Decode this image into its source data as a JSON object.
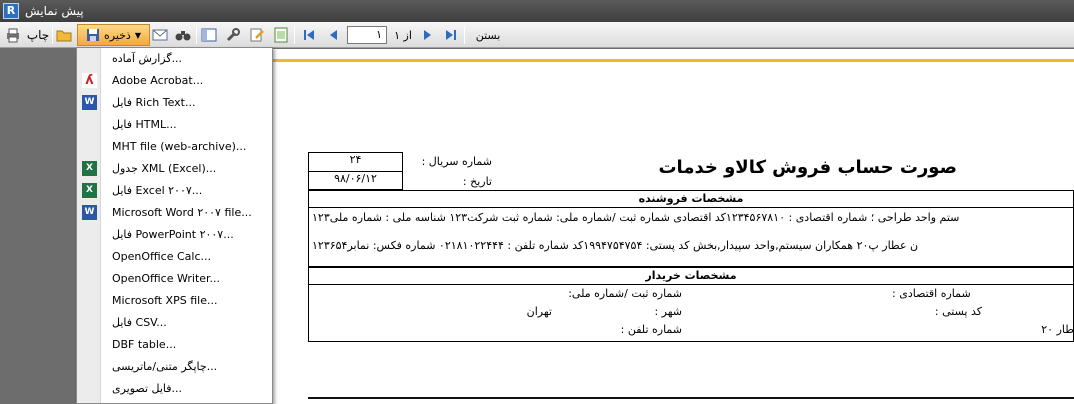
{
  "window": {
    "title": "پیش نمایش",
    "app_icon_letter": "R"
  },
  "toolbar": {
    "print_label": "چاپ",
    "save_label": "ذخیره",
    "page_number": "۱",
    "page_of": "از ۱",
    "close_label": "بستن"
  },
  "menu": {
    "items": [
      {
        "label": "گزارش آماده...",
        "icon": ""
      },
      {
        "label": "Adobe Acrobat...",
        "icon": "pdf-icon"
      },
      {
        "label": "فایل Rich Text...",
        "icon": "word-icon"
      },
      {
        "label": "فایل HTML...",
        "icon": ""
      },
      {
        "label": "MHT file (web-archive)...",
        "icon": ""
      },
      {
        "label": "جدول XML (Excel)...",
        "icon": "excel-icon"
      },
      {
        "label": "فایل Excel ۲۰۰۷...",
        "icon": "excel-icon"
      },
      {
        "label": "Microsoft Word ۲۰۰۷ file...",
        "icon": "word-icon"
      },
      {
        "label": "فایل PowerPoint ۲۰۰۷...",
        "icon": ""
      },
      {
        "label": "OpenOffice Calc...",
        "icon": ""
      },
      {
        "label": "OpenOffice Writer...",
        "icon": ""
      },
      {
        "label": "Microsoft XPS file...",
        "icon": ""
      },
      {
        "label": "فایل CSV...",
        "icon": ""
      },
      {
        "label": "DBF table...",
        "icon": ""
      },
      {
        "label": "چاپگر متنی/ماتریسی...",
        "icon": ""
      },
      {
        "label": "فایل تصویری...",
        "icon": ""
      }
    ]
  },
  "invoice": {
    "title": "صورت حساب فروش کالاو خدمات",
    "serial_label": "شماره سریال :",
    "serial_value": "۲۴",
    "date_label": "تاریخ :",
    "date_value": "۹۸/۰۶/۱۲",
    "seller_header": "مشخصات فروشنده",
    "seller_name_line": "ستم واحد طراحی ؛ شماره اقتصادی : ۱۲۳۴۵۶۷۸۱۰کد اقتصادی  شماره ثبت /شماره ملی:   شماره ثبت شرکت۱۲۳   شناسه ملی :   شماره ملی۱۲۳",
    "seller_address_line": "ن عطار پ۲۰ همکاران سیستم,واحد سپیدار,بخش        کد پستی:   ۱۹۹۴۷۵۴۷۵۴کد   شماره تلفن :   ۰۲۱۸۱۰۲۲۴۴۴   شماره فکس:   نمابر۱۲۳۶۵۴",
    "buyer_header": "مشخصات خریدار",
    "buyer_econ_label": "شماره اقتصادی :",
    "buyer_reg_label": "شماره ثبت /شماره ملی:",
    "buyer_postal_label": "کد پستی :",
    "buyer_city_label": "شهر :",
    "buyer_city_value": "تهران",
    "buyer_address_value": "طار ۲۰",
    "buyer_phone_label": "شماره تلفن :"
  },
  "colors": {
    "accent": "#f1b82c",
    "save_button": "#f4a83c",
    "title_bar": "#4a4a4a"
  }
}
